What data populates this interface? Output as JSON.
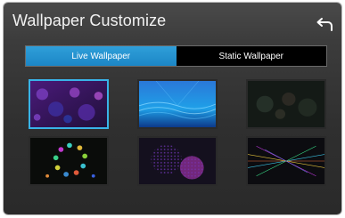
{
  "header": {
    "title": "Wallpaper Customize",
    "back_icon": "back-arrow-icon"
  },
  "tabs": [
    {
      "label": "Live Wallpaper",
      "active": true
    },
    {
      "label": "Static Wallpaper",
      "active": false
    }
  ],
  "wallpapers": [
    {
      "name": "purple-bubbles",
      "selected": true
    },
    {
      "name": "blue-waves",
      "selected": false
    },
    {
      "name": "dark-bokeh",
      "selected": false
    },
    {
      "name": "colored-particles-ring",
      "selected": false
    },
    {
      "name": "purple-dots",
      "selected": false
    },
    {
      "name": "neon-lines",
      "selected": false
    }
  ],
  "colors": {
    "accent": "#2f9fd9",
    "selection_border": "#39b3e8",
    "background": "#2f2f2f"
  }
}
